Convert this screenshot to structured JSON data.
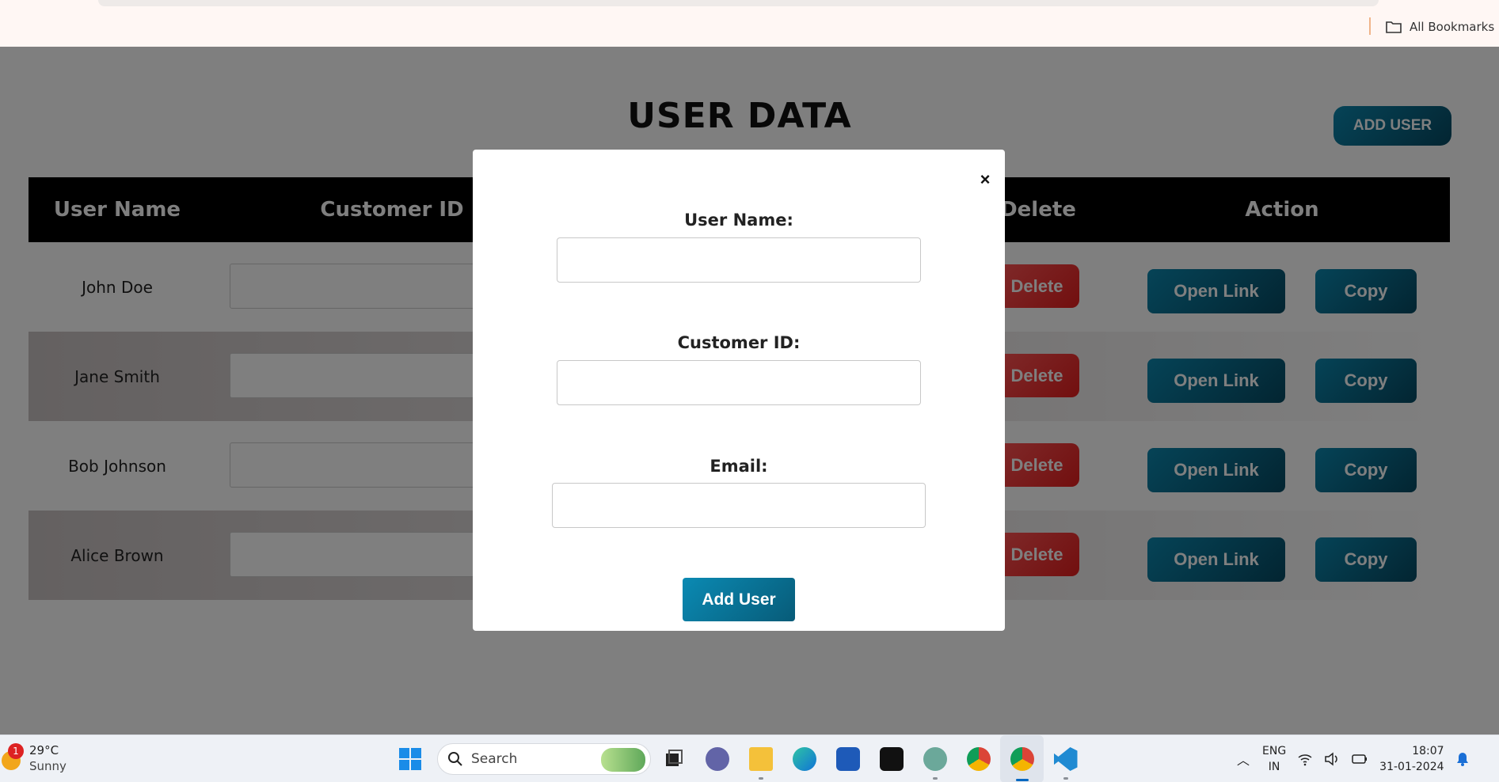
{
  "browser": {
    "bookmarks_label": "All Bookmarks"
  },
  "page": {
    "title": "USER DATA",
    "add_user_label": "ADD USER"
  },
  "table": {
    "headers": [
      "User Name",
      "Customer ID",
      "Delete",
      "Action"
    ],
    "rows": [
      {
        "name": "John Doe",
        "delete": "Delete",
        "open": "Open Link",
        "copy": "Copy"
      },
      {
        "name": "Jane Smith",
        "delete": "Delete",
        "open": "Open Link",
        "copy": "Copy"
      },
      {
        "name": "Bob Johnson",
        "delete": "Delete",
        "open": "Open Link",
        "copy": "Copy"
      },
      {
        "name": "Alice Brown",
        "delete": "Delete",
        "open": "Open Link",
        "copy": "Copy"
      }
    ]
  },
  "modal": {
    "close_symbol": "×",
    "username_label": "User Name:",
    "customer_id_label": "Customer ID:",
    "email_label": "Email:",
    "submit_label": "Add User",
    "username_value": "",
    "customer_id_value": "",
    "email_value": ""
  },
  "taskbar": {
    "weather_temp": "29°C",
    "weather_desc": "Sunny",
    "notification_count": "1",
    "search_placeholder": "Search",
    "language_line1": "ENG",
    "language_line2": "IN",
    "time": "18:07",
    "date": "31-01-2024"
  },
  "colors": {
    "primary_gradient_start": "#0c87ae",
    "primary_gradient_end": "#064a63",
    "delete_red": "#e41e1e",
    "header_black": "#000000"
  }
}
